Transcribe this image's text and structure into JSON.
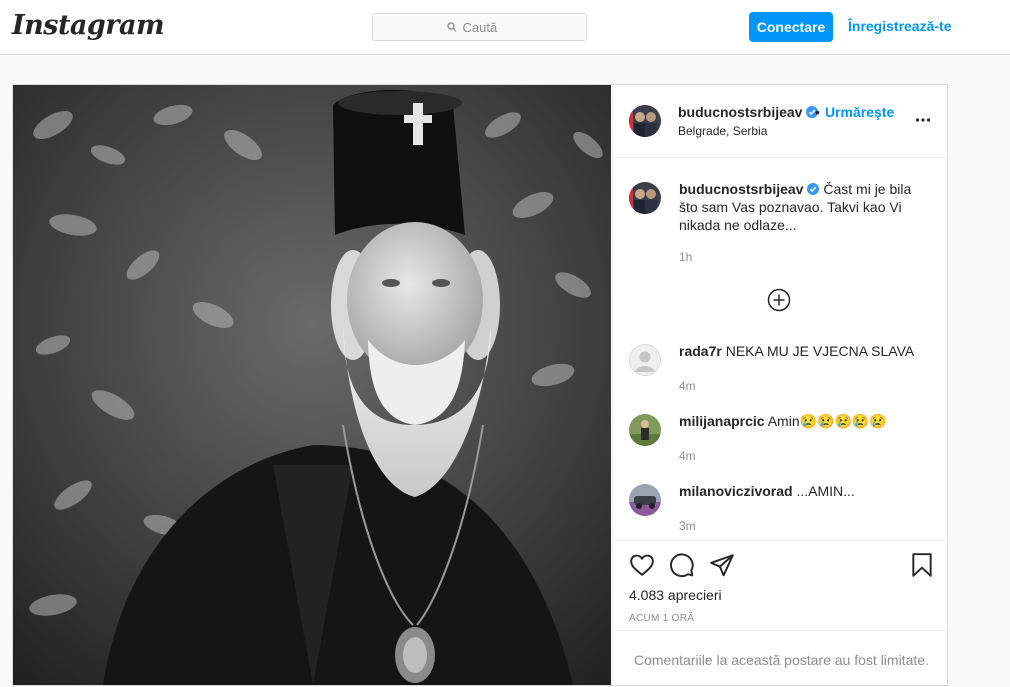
{
  "header": {
    "logo": "Instagram",
    "search_placeholder": "Caută",
    "login_label": "Conectare",
    "signup_label": "Înregistrează-te"
  },
  "post": {
    "username": "buducnostsrbijeav",
    "separator": "•",
    "follow_label": "Urmăreşte",
    "location": "Belgrade, Serbia",
    "caption": {
      "username": "buducnostsrbijeav",
      "text": "Čast mi je bila što sam Vas poznavao. Takvi kao Vi nikada ne odlaze...",
      "time": "1h"
    },
    "comments": [
      {
        "username": "rada7r",
        "text": "NEKA MU JE VJECNA SLAVA",
        "time": "4m"
      },
      {
        "username": "milijanaprcic",
        "text": "Amin😢😢😢😢😢",
        "time": "4m"
      },
      {
        "username": "milanoviczivorad",
        "text": "...AMIN...",
        "time": "3m"
      }
    ],
    "likes": "4.083 aprecieri",
    "posted_ago": "ACUM 1 ORĂ",
    "comments_limited": "Comentariile la această postare au fost limitate."
  },
  "icons": {
    "search": "search-icon",
    "verified": "verified-badge-icon",
    "more": "more-options-icon",
    "load_more": "plus-circle-icon",
    "like": "heart-icon",
    "comment": "comment-icon",
    "share": "paper-plane-icon",
    "save": "bookmark-icon"
  },
  "colors": {
    "accent": "#0095f6",
    "text": "#262626",
    "muted": "#8e8e8e",
    "border": "#dbdbdb"
  }
}
